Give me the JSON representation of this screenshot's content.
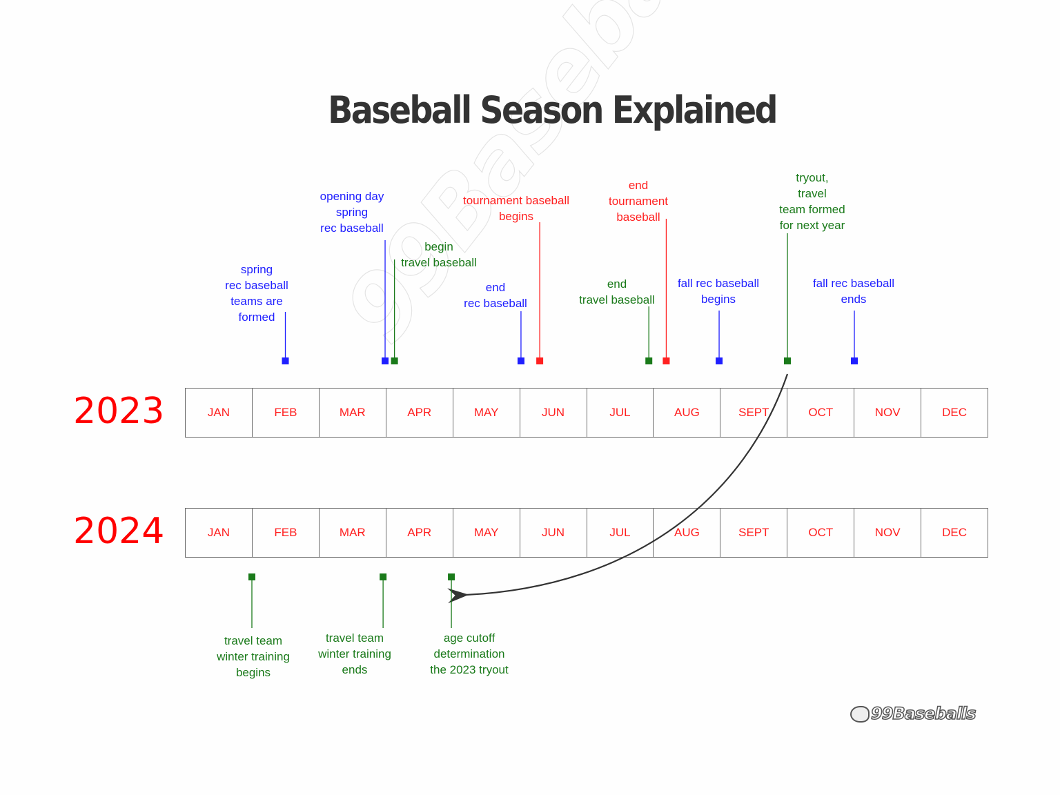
{
  "title": "Baseball Season Explained",
  "watermark": "99Baseballs",
  "logo": "99Baseballs",
  "colors": {
    "rec_baseball": "#1f1fff",
    "travel_baseball": "#1a7a1a",
    "tournament_baseball": "#ff2020",
    "month_text": "#ff2020",
    "year_text": "#ff0000"
  },
  "years": [
    {
      "label": "2023",
      "months": [
        "JAN",
        "FEB",
        "MAR",
        "APR",
        "MAY",
        "JUN",
        "JUL",
        "AUG",
        "SEPT",
        "OCT",
        "NOV",
        "DEC"
      ]
    },
    {
      "label": "2024",
      "months": [
        "JAN",
        "FEB",
        "MAR",
        "APR",
        "MAY",
        "JUN",
        "JUL",
        "AUG",
        "SEPT",
        "OCT",
        "NOV",
        "DEC"
      ]
    }
  ],
  "events_2023": [
    {
      "lines": [
        "spring",
        "rec baseball",
        "teams are",
        "formed"
      ],
      "category": "rec_baseball",
      "month_position": 2.5
    },
    {
      "lines": [
        "opening day",
        "spring",
        "rec baseball"
      ],
      "category": "rec_baseball",
      "month_position": 3.99
    },
    {
      "lines": [
        "begin",
        "travel baseball"
      ],
      "category": "travel_baseball",
      "month_position": 4.13
    },
    {
      "lines": [
        "end",
        "rec baseball"
      ],
      "category": "rec_baseball",
      "month_position": 6.02
    },
    {
      "lines": [
        "tournament baseball",
        "begins"
      ],
      "category": "tournament_baseball",
      "month_position": 6.3
    },
    {
      "lines": [
        "end",
        "travel baseball"
      ],
      "category": "travel_baseball",
      "month_position": 7.93
    },
    {
      "lines": [
        "end",
        "tournament",
        "baseball"
      ],
      "category": "tournament_baseball",
      "month_position": 8.19
    },
    {
      "lines": [
        "fall rec baseball",
        "begins"
      ],
      "category": "rec_baseball",
      "month_position": 8.98
    },
    {
      "lines": [
        "tryout,",
        "travel",
        "team formed",
        "for next year"
      ],
      "category": "travel_baseball",
      "month_position": 10.0
    },
    {
      "lines": [
        "fall rec baseball",
        "ends"
      ],
      "category": "rec_baseball",
      "month_position": 11.0
    }
  ],
  "events_2024": [
    {
      "lines": [
        "travel team",
        "winter training",
        "begins"
      ],
      "category": "travel_baseball",
      "month_position": 2.0
    },
    {
      "lines": [
        "travel team",
        "winter training",
        "ends"
      ],
      "category": "travel_baseball",
      "month_position": 3.96
    },
    {
      "lines": [
        "age cutoff",
        "determination",
        "the 2023 tryout"
      ],
      "category": "travel_baseball",
      "month_position": 4.98
    }
  ],
  "arrow": {
    "from": "tryout, travel team formed for next year (2023)",
    "to": "age cutoff determination the 2023 tryout (2024)"
  }
}
